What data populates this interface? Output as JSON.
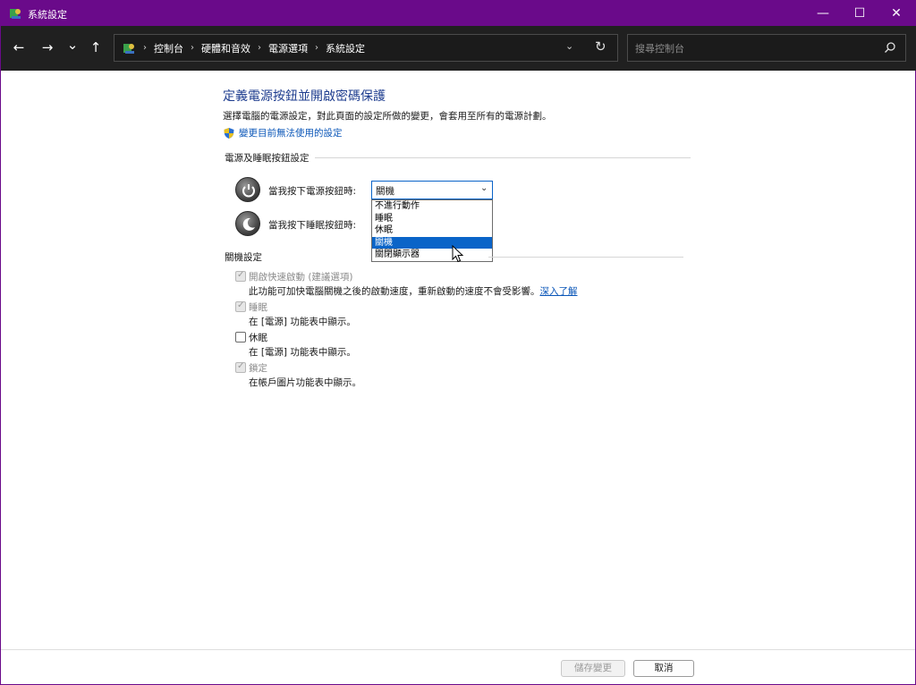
{
  "window": {
    "title": "系統設定",
    "controls": {
      "minimize": "—",
      "maximize": "☐",
      "close": "✕"
    },
    "accent": "#6a0a8a"
  },
  "nav": {
    "back": "←",
    "forward": "→",
    "recent": "⌄",
    "up": "↑",
    "breadcrumbs": [
      "控制台",
      "硬體和音效",
      "電源選項",
      "系統設定"
    ],
    "separator": "›",
    "search_placeholder": "搜尋控制台"
  },
  "main": {
    "title": "定義電源按鈕並開啟密碼保護",
    "description": "選擇電腦的電源設定，對此頁面的設定所做的變更，會套用至所有的電源計劃。",
    "admin_link": "變更目前無法使用的設定",
    "power_section": {
      "heading": "電源及睡眠按鈕設定",
      "power_button_label": "當我按下電源按鈕時:",
      "power_button_value": "關機",
      "sleep_button_label": "當我按下睡眠按鈕時:",
      "dropdown_options": [
        "不進行動作",
        "睡眠",
        "休眠",
        "關機",
        "關閉顯示器"
      ],
      "dropdown_selected_index": 3
    },
    "shutdown_section": {
      "heading": "關機設定",
      "options": [
        {
          "label": "開啟快速啟動 (建議選項)",
          "desc": "此功能可加快電腦關機之後的啟動速度，重新啟動的速度不會受影響。",
          "link": "深入了解",
          "checked": true,
          "enabled": false
        },
        {
          "label": "睡眠",
          "desc": "在 [電源] 功能表中顯示。",
          "checked": true,
          "enabled": false
        },
        {
          "label": "休眠",
          "desc": "在 [電源] 功能表中顯示。",
          "checked": false,
          "enabled": true
        },
        {
          "label": "鎖定",
          "desc": "在帳戶圖片功能表中顯示。",
          "checked": true,
          "enabled": false
        }
      ]
    }
  },
  "footer": {
    "save_label": "儲存變更",
    "cancel_label": "取消"
  }
}
